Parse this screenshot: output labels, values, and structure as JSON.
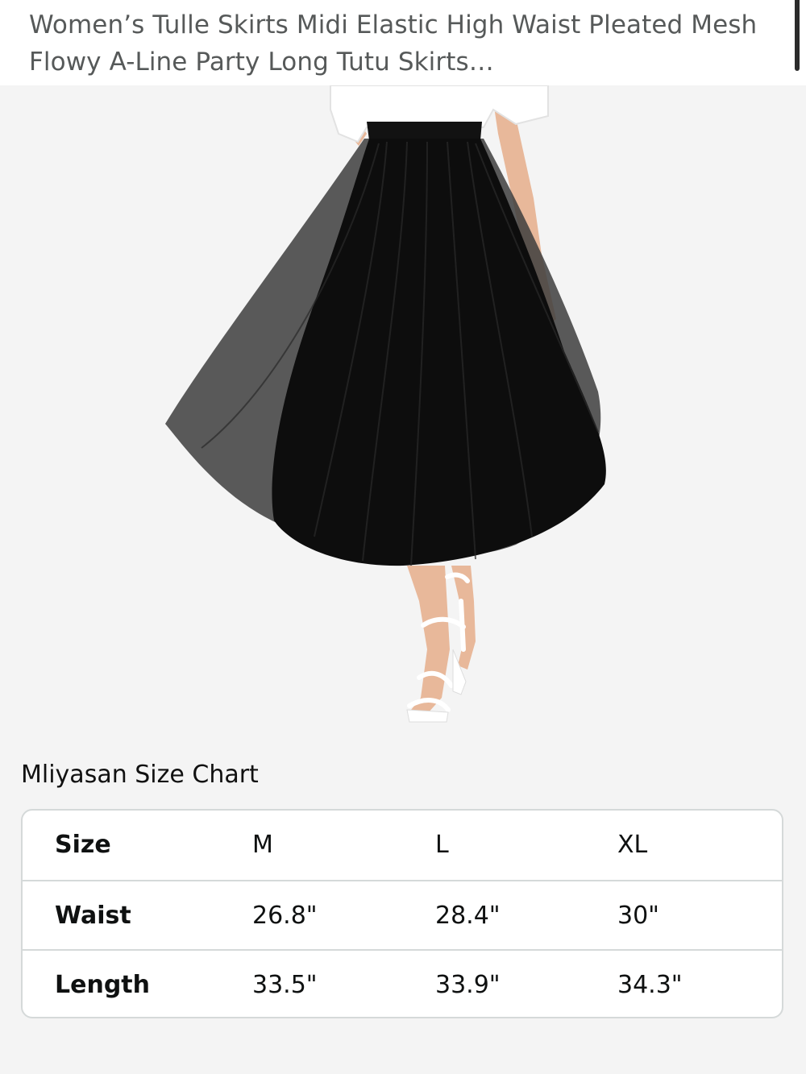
{
  "product": {
    "title": "Women’s Tulle Skirts Midi Elastic High Waist Pleated Mesh Flowy A-Line Party Long Tutu Skirts…"
  },
  "size_chart": {
    "title": "Mliyasan Size Chart",
    "rows": [
      {
        "label": "Size",
        "values": [
          "M",
          "L",
          "XL"
        ]
      },
      {
        "label": "Waist",
        "values": [
          "26.8\"",
          "28.4\"",
          "30\""
        ]
      },
      {
        "label": "Length",
        "values": [
          "33.5\"",
          "33.9\"",
          "34.3\""
        ]
      }
    ]
  },
  "colors": {
    "background": "#f4f4f4",
    "header_bg": "#ffffff",
    "title_text": "#565959",
    "table_border": "#d5d9d9"
  }
}
